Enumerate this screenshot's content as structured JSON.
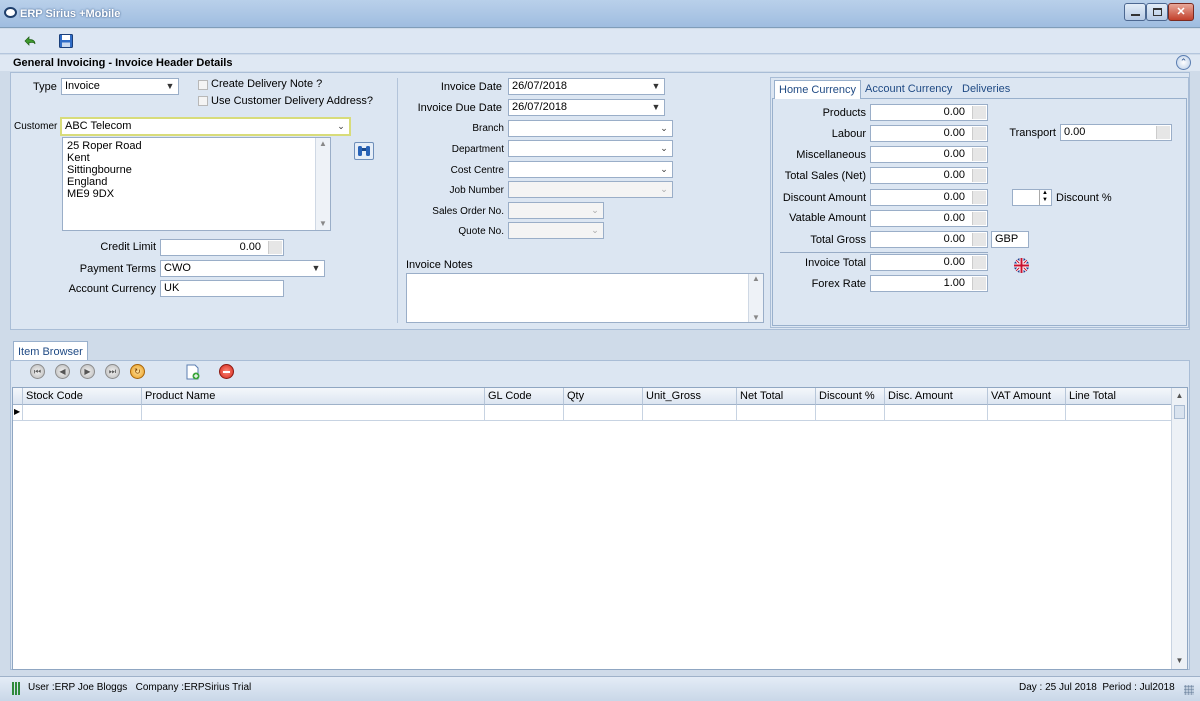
{
  "window": {
    "title": "ERP Sirius +Mobile"
  },
  "section": {
    "title": "General Invoicing - Invoice Header Details"
  },
  "form": {
    "type_label": "Type",
    "type_value": "Invoice",
    "create_delivery_label": "Create Delivery Note ?",
    "use_customer_delivery_label": "Use Customer Delivery Address?",
    "customer_label": "Customer",
    "customer_value": "ABC Telecom",
    "address_lines": [
      "25 Roper Road",
      "Kent",
      "Sittingbourne",
      "England",
      "ME9 9DX"
    ],
    "credit_limit_label": "Credit Limit",
    "credit_limit_value": "0.00",
    "payment_terms_label": "Payment Terms",
    "payment_terms_value": "CWO",
    "account_currency_label": "Account Currency",
    "account_currency_value": "UK",
    "invoice_date_label": "Invoice Date",
    "invoice_date_value": "26/07/2018",
    "invoice_due_date_label": "Invoice Due Date",
    "invoice_due_date_value": "26/07/2018",
    "branch_label": "Branch",
    "department_label": "Department",
    "cost_centre_label": "Cost Centre",
    "job_number_label": "Job Number",
    "sales_order_label": "Sales Order No.",
    "quote_label": "Quote No.",
    "invoice_notes_label": "Invoice Notes"
  },
  "totals": {
    "tabs": [
      "Home Currency",
      "Account Currency",
      "Deliveries"
    ],
    "products_label": "Products",
    "products_value": "0.00",
    "labour_label": "Labour",
    "labour_value": "0.00",
    "transport_label": "Transport",
    "transport_value": "0.00",
    "misc_label": "Miscellaneous",
    "misc_value": "0.00",
    "total_sales_label": "Total Sales (Net)",
    "total_sales_value": "0.00",
    "discount_amount_label": "Discount Amount",
    "discount_amount_value": "0.00",
    "discount_pct_label": "Discount %",
    "vatable_label": "Vatable Amount",
    "vatable_value": "0.00",
    "total_gross_label": "Total Gross",
    "total_gross_value": "0.00",
    "currency_code": "GBP",
    "invoice_total_label": "Invoice Total",
    "invoice_total_value": "0.00",
    "forex_label": "Forex Rate",
    "forex_value": "1.00"
  },
  "browser": {
    "tab_label": "Item Browser",
    "columns": [
      "Stock Code",
      "Product Name",
      "GL Code",
      "Qty",
      "Unit_Gross",
      "Net Total",
      "Discount %",
      "Disc. Amount",
      "VAT Amount",
      "Line Total"
    ]
  },
  "status": {
    "left": "User :ERP Joe Bloggs   Company :ERPSirius Trial",
    "right": "Day : 25 Jul 2018  Period : Jul2018"
  }
}
